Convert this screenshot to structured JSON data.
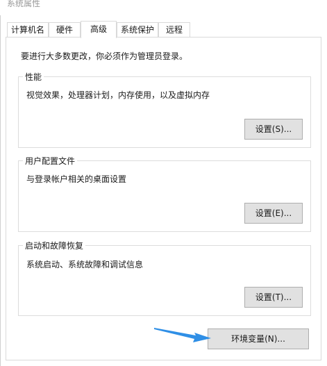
{
  "window": {
    "title": "系统属性"
  },
  "tabs": [
    {
      "label": "计算机名",
      "active": false
    },
    {
      "label": "硬件",
      "active": false
    },
    {
      "label": "高级",
      "active": true
    },
    {
      "label": "系统保护",
      "active": false
    },
    {
      "label": "远程",
      "active": false
    }
  ],
  "admin_note": "要进行大多数更改，你必须作为管理员登录。",
  "groups": {
    "performance": {
      "legend": "性能",
      "description": "视觉效果，处理器计划，内存使用，以及虚拟内存",
      "button": "设置(S)..."
    },
    "user_profiles": {
      "legend": "用户配置文件",
      "description": "与登录帐户相关的桌面设置",
      "button": "设置(E)..."
    },
    "startup_recovery": {
      "legend": "启动和故障恢复",
      "description": "系统启动、系统故障和调试信息",
      "button": "设置(T)..."
    }
  },
  "env_button": "环境变量(N)...",
  "colors": {
    "arrow": "#2f8fe6",
    "button_bg": "#e1e1e1",
    "border": "#d9d9d9"
  },
  "icons": {
    "annotation": "arrow-right-icon"
  }
}
